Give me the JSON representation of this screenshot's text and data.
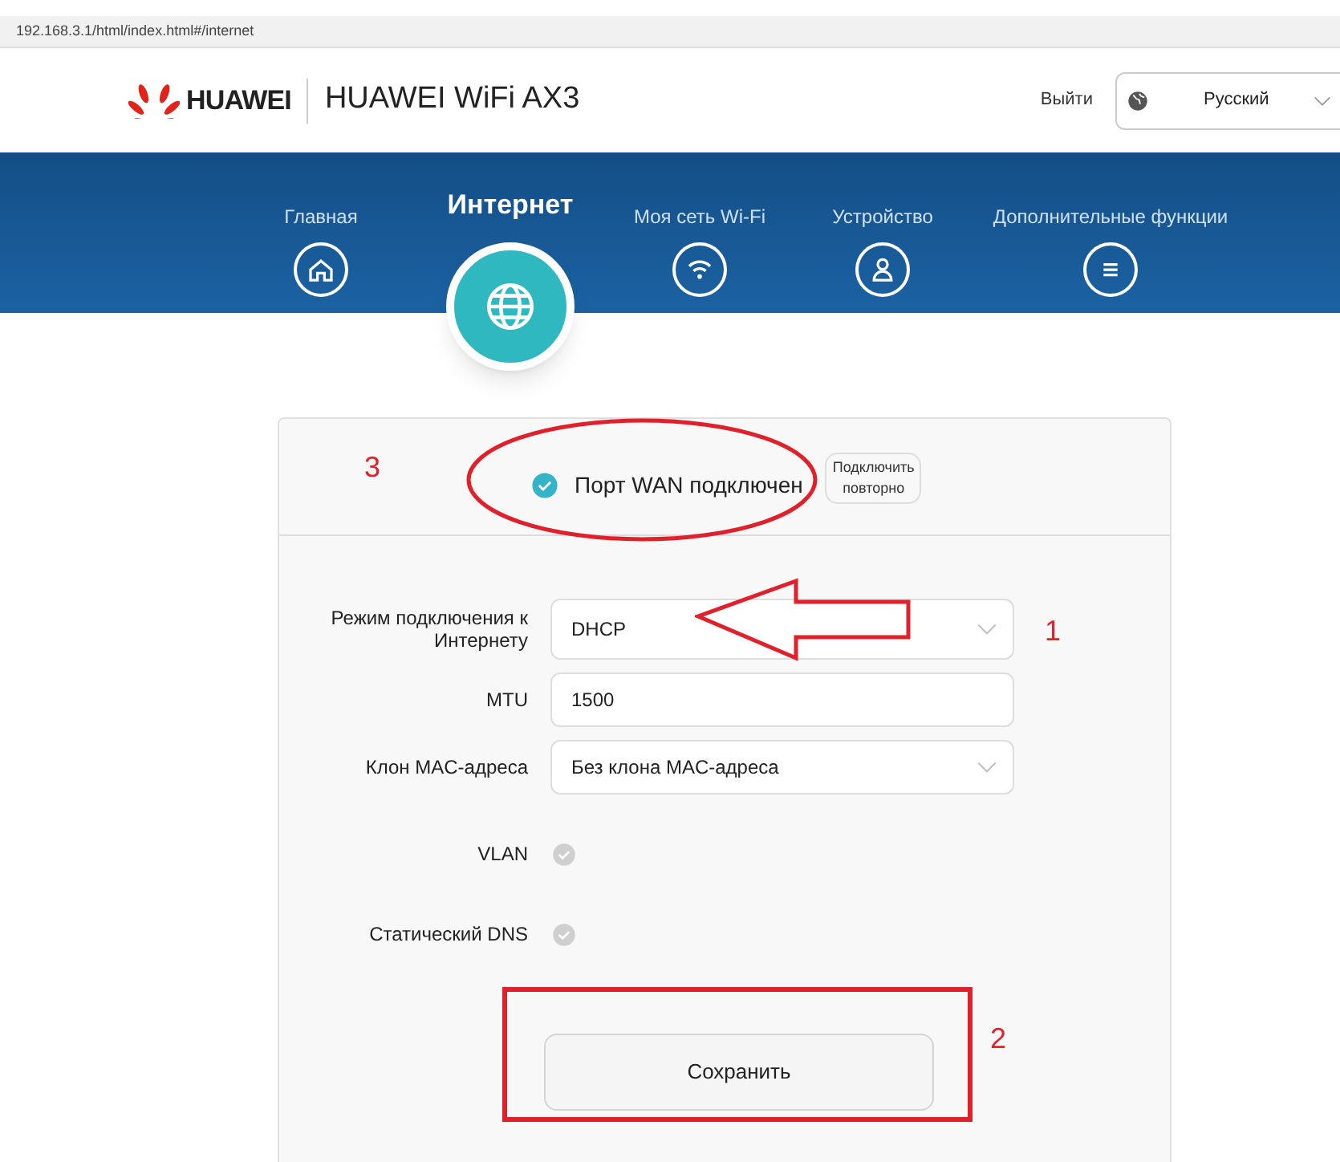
{
  "browser": {
    "url": "192.168.3.1/html/index.html#/internet"
  },
  "header": {
    "brand": "HUAWEI",
    "product": "HUAWEI WiFi AX3",
    "logout": "Выйти",
    "language": "Русский"
  },
  "nav": [
    {
      "label": "Главная",
      "kind": "home",
      "selected": false
    },
    {
      "label": "Интернет",
      "kind": "globe",
      "selected": true
    },
    {
      "label": "Моя сеть Wi-Fi",
      "kind": "wifi",
      "selected": false
    },
    {
      "label": "Устройство",
      "kind": "user",
      "selected": false
    },
    {
      "label": "Дополнительные функции",
      "kind": "menu",
      "selected": false
    }
  ],
  "status": {
    "text": "Порт WAN подключен",
    "connected": true,
    "reconnect_button": "Подключить повторно"
  },
  "form": [
    {
      "kind": "select",
      "label": "Режим подключения к Интернету",
      "value": "DHCP"
    },
    {
      "kind": "input",
      "label": "MTU",
      "value": "1500"
    },
    {
      "kind": "select",
      "label": "Клон MAC-адреса",
      "value": "Без клона MAC-адреса"
    },
    {
      "kind": "toggle",
      "label": "VLAN",
      "checked": false
    },
    {
      "kind": "toggle",
      "label": "Статический DNS",
      "checked": false
    }
  ],
  "save_button": "Сохранить",
  "annotations": [
    {
      "kind": "ellipse",
      "number": "3"
    },
    {
      "kind": "arrow",
      "number": "1"
    },
    {
      "kind": "rectangle",
      "number": "2"
    }
  ]
}
